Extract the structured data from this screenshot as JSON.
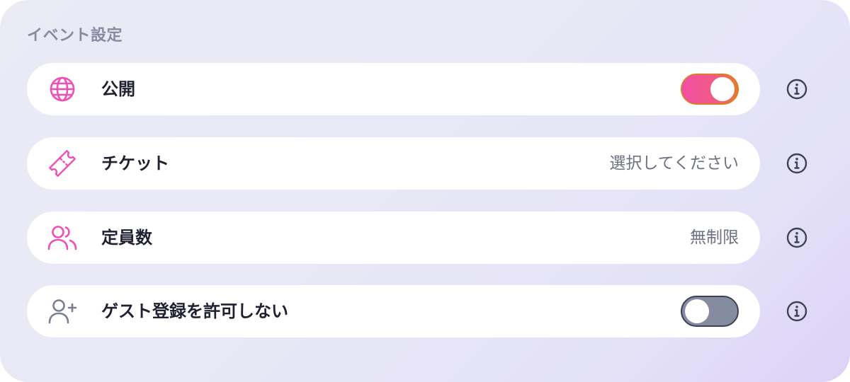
{
  "section": {
    "title": "イベント設定"
  },
  "colors": {
    "accent": "#f24ea6",
    "toggle_off": "#858ba0",
    "icon_muted": "#7a7f94",
    "info_icon": "#3d4153"
  },
  "rows": [
    {
      "label": "公開",
      "icon": "globe-icon",
      "control": "toggle",
      "toggle_on": true
    },
    {
      "label": "チケット",
      "icon": "ticket-icon",
      "control": "select",
      "value": "選択してください"
    },
    {
      "label": "定員数",
      "icon": "users-icon",
      "control": "select",
      "value": "無制限"
    },
    {
      "label": "ゲスト登録を許可しない",
      "icon": "user-plus-icon",
      "control": "toggle",
      "toggle_on": false
    }
  ]
}
